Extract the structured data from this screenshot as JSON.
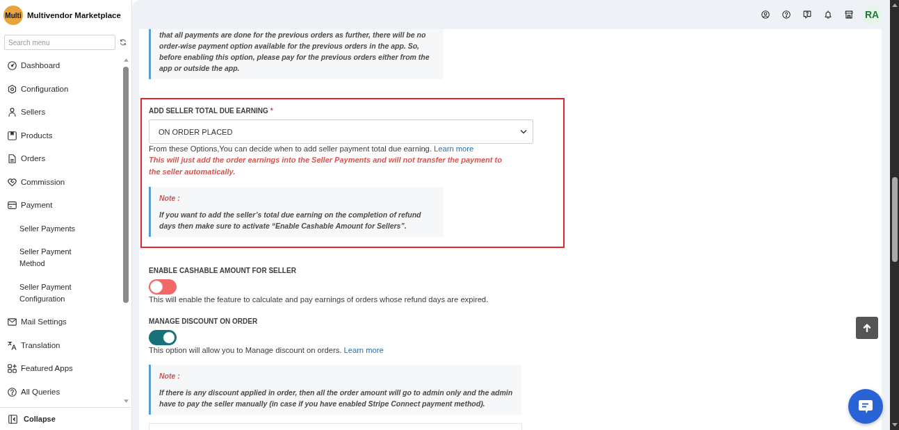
{
  "brand": {
    "logo": "Multi",
    "name": "Multivendor Marketplace"
  },
  "sidebar": {
    "search": {
      "placeholder": "Search menu"
    },
    "items": [
      {
        "label": "Dashboard",
        "selected": false
      },
      {
        "label": "Configuration",
        "selected": false
      },
      {
        "label": "Sellers",
        "selected": false
      },
      {
        "label": "Products",
        "selected": false
      },
      {
        "label": "Orders",
        "selected": false
      },
      {
        "label": "Commission",
        "selected": false
      },
      {
        "label": "Payment",
        "selected": false,
        "children": [
          {
            "label": "Seller Payments",
            "selected": false
          },
          {
            "label": "Seller Payment Method",
            "selected": false
          },
          {
            "label": "Seller Payment Configuration",
            "selected": false
          }
        ]
      },
      {
        "label": "Mail Settings",
        "selected": false
      },
      {
        "label": "Translation",
        "selected": false
      },
      {
        "label": "Featured Apps",
        "selected": false
      },
      {
        "label": "All Queries",
        "selected": false
      }
    ],
    "collapse": "Collapse"
  },
  "header": {
    "avatar": "RA"
  },
  "content": {
    "top_note": "that all payments are done for the previous orders as further, there will be no order-wise payment option available for the previous orders in the app. So, before enabling this option, please pay for the previous orders either from the app or outside the app.",
    "settings": [
      {
        "kind": "select",
        "highlighted": true,
        "label": "ADD SELLER TOTAL DUE EARNING",
        "required_mark": "*",
        "value": "ON ORDER PLACED",
        "help": "From these Options,You can decide when to add seller payment total due earning.",
        "link": "Learn more",
        "warning": "This will just add the order earnings into the Seller Payments and will not transfer the payment to the seller automatically.",
        "note": {
          "title": "Note :",
          "text": "If you want to add the seller’s total due earning on the completion of refund days then make sure to activate “Enable Cashable Amount for Sellers”."
        }
      },
      {
        "kind": "toggle",
        "highlighted": false,
        "label": "ENABLE CASHABLE AMOUNT FOR SELLER",
        "on": false,
        "help": "This will enable the feature to calculate and pay earnings of orders whose refund days are expired."
      },
      {
        "kind": "toggle",
        "highlighted": false,
        "label": "MANAGE DISCOUNT ON ORDER",
        "on": true,
        "help": "This option will allow you to Manage discount on orders.",
        "link": "Learn more",
        "note": {
          "title": "Note :",
          "text": "If there is any discount applied in order, then all the order amount will go to admin only and the admin have to pay the seller manually (in case if you have enabled Stripe Connect payment method)."
        }
      }
    ]
  }
}
